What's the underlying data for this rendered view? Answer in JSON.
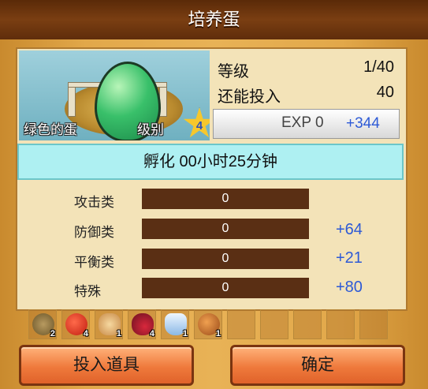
{
  "title": "培养蛋",
  "egg": {
    "name": "绿色的蛋",
    "level_label": "级别",
    "rank_glyph": "4"
  },
  "stats": {
    "level_label": "等级",
    "level_value": "1/40",
    "invest_label": "还能投入",
    "invest_value": "40"
  },
  "exp": {
    "label": "EXP 0",
    "gain": "+344"
  },
  "hatch_text": "孵化 00小时25分钟",
  "categories": [
    {
      "label": "攻击类",
      "value": "0",
      "gain": ""
    },
    {
      "label": "防御类",
      "value": "0",
      "gain": "+64"
    },
    {
      "label": "平衡类",
      "value": "0",
      "gain": "+21"
    },
    {
      "label": "特殊",
      "value": "0",
      "gain": "+80"
    }
  ],
  "items": [
    {
      "icon": "rope-coil-icon",
      "qty": "2"
    },
    {
      "icon": "tomato-icon",
      "qty": "4"
    },
    {
      "icon": "bread-bun-icon",
      "qty": "1"
    },
    {
      "icon": "berries-icon",
      "qty": "4"
    },
    {
      "icon": "potion-bottle-icon",
      "qty": "1"
    },
    {
      "icon": "roast-chicken-icon",
      "qty": "1"
    }
  ],
  "buttons": {
    "invest": "投入道具",
    "confirm": "确定"
  },
  "colors": {
    "gain": "#2d5ad6",
    "bar": "#5a2f14",
    "button": "#ef7a3c",
    "hatch_bg": "#aef0f2"
  }
}
